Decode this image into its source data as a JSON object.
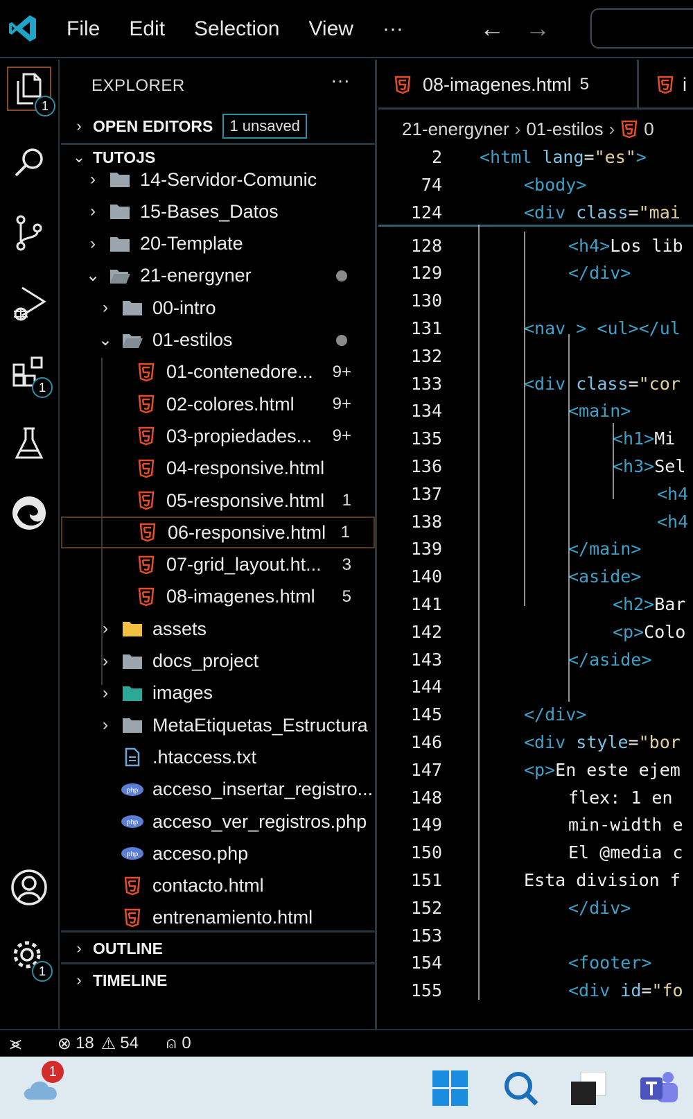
{
  "menu": [
    "File",
    "Edit",
    "Selection",
    "View",
    "···"
  ],
  "activity_bar": {
    "explorer_badge": "1",
    "extensions_badge": "1",
    "settings_badge": "1"
  },
  "sidebar": {
    "title": "EXPLORER",
    "more": "···",
    "open_editors": {
      "label": "OPEN EDITORS",
      "unsaved": "1 unsaved"
    },
    "root": "TUTOJS",
    "tree": [
      {
        "label": "14-Servidor-Comunic",
        "type": "folder",
        "level": 1,
        "expanded": false
      },
      {
        "label": "15-Bases_Datos",
        "type": "folder",
        "level": 1,
        "expanded": false
      },
      {
        "label": "20-Template",
        "type": "folder",
        "level": 1,
        "expanded": false
      },
      {
        "label": "21-energyner",
        "type": "folder-open",
        "level": 1,
        "expanded": true,
        "modified": true
      },
      {
        "label": "00-intro",
        "type": "folder",
        "level": 2,
        "expanded": false
      },
      {
        "label": "01-estilos",
        "type": "folder-open",
        "level": 2,
        "expanded": true,
        "modified": true
      },
      {
        "label": "01-contenedore...",
        "type": "html",
        "level": 3,
        "count": "9+"
      },
      {
        "label": "02-colores.html",
        "type": "html",
        "level": 3,
        "count": "9+"
      },
      {
        "label": "03-propiedades...",
        "type": "html",
        "level": 3,
        "count": "9+"
      },
      {
        "label": "04-responsive.html",
        "type": "html",
        "level": 3,
        "count": ""
      },
      {
        "label": "05-responsive.html",
        "type": "html",
        "level": 3,
        "count": "1"
      },
      {
        "label": "06-responsive.html",
        "type": "html",
        "level": 3,
        "count": "1",
        "selected": true
      },
      {
        "label": "07-grid_layout.ht...",
        "type": "html",
        "level": 3,
        "count": "3"
      },
      {
        "label": "08-imagenes.html",
        "type": "html",
        "level": 3,
        "count": "5"
      },
      {
        "label": "assets",
        "type": "folder-assets",
        "level": 2,
        "expanded": false
      },
      {
        "label": "docs_project",
        "type": "folder",
        "level": 2,
        "expanded": false
      },
      {
        "label": "images",
        "type": "folder-images",
        "level": 2,
        "expanded": false
      },
      {
        "label": "MetaEtiquetas_Estructura",
        "type": "folder",
        "level": 2,
        "expanded": false
      },
      {
        "label": ".htaccess.txt",
        "type": "txt",
        "level": 2
      },
      {
        "label": "acceso_insertar_registro...",
        "type": "php",
        "level": 2
      },
      {
        "label": "acceso_ver_registros.php",
        "type": "php",
        "level": 2
      },
      {
        "label": "acceso.php",
        "type": "php",
        "level": 2
      },
      {
        "label": "contacto.html",
        "type": "html",
        "level": 2
      },
      {
        "label": "entrenamiento.html",
        "type": "html",
        "level": 2
      }
    ],
    "outline": "OUTLINE",
    "timeline": "TIMELINE"
  },
  "editor": {
    "tabs": [
      {
        "label": "08-imagenes.html",
        "count": "5"
      },
      {
        "label": "i",
        "count": ""
      }
    ],
    "breadcrumb": [
      "21-energyner",
      "01-estilos",
      "0"
    ],
    "sticky": [
      {
        "ln": "2",
        "indent": 0,
        "html": "<span class='tag'>&lt;html</span> <span class='attr'>lang</span>=<span class='str'>\"es\"</span><span class='tag'>&gt;</span>"
      },
      {
        "ln": "74",
        "indent": 1,
        "html": "<span class='tag'>&lt;body&gt;</span>"
      },
      {
        "ln": "124",
        "indent": 1,
        "html": "<span class='tag'>&lt;div</span> <span class='attr'>class</span>=<span class='str'>\"mai</span>"
      }
    ],
    "lines": [
      {
        "ln": "128",
        "indent": 2,
        "html": "<span class='tag'>&lt;h4&gt;</span><span class='txt'>Los lib</span>"
      },
      {
        "ln": "129",
        "indent": 2,
        "html": "<span class='tag'>&lt;/div&gt;</span>"
      },
      {
        "ln": "130",
        "indent": 0,
        "html": ""
      },
      {
        "ln": "131",
        "indent": 1,
        "html": "<span class='tag'>&lt;nav</span> <span class='tag'>&gt;</span> <span class='tag'>&lt;ul&gt;&lt;/ul</span>"
      },
      {
        "ln": "132",
        "indent": 0,
        "html": ""
      },
      {
        "ln": "133",
        "indent": 1,
        "html": "<span class='tag'>&lt;div</span> <span class='attr'>class</span>=<span class='str'>\"cor</span>"
      },
      {
        "ln": "134",
        "indent": 2,
        "html": "<span class='tag'>&lt;main&gt;</span>"
      },
      {
        "ln": "135",
        "indent": 3,
        "html": "<span class='tag'>&lt;h1&gt;</span><span class='txt'>Mi </span>"
      },
      {
        "ln": "136",
        "indent": 3,
        "html": "<span class='tag'>&lt;h3&gt;</span><span class='txt'>Sel</span>"
      },
      {
        "ln": "137",
        "indent": 4,
        "html": "<span class='tag'>&lt;h4</span>"
      },
      {
        "ln": "138",
        "indent": 4,
        "html": "<span class='tag'>&lt;h4</span>"
      },
      {
        "ln": "139",
        "indent": 2,
        "html": "<span class='tag'>&lt;/main&gt;</span>"
      },
      {
        "ln": "140",
        "indent": 2,
        "html": "<span class='tag'>&lt;aside&gt;</span>"
      },
      {
        "ln": "141",
        "indent": 3,
        "html": "<span class='tag'>&lt;h2&gt;</span><span class='txt'>Bar</span>"
      },
      {
        "ln": "142",
        "indent": 3,
        "html": "<span class='tag'>&lt;p&gt;</span><span class='txt'>Colo</span>"
      },
      {
        "ln": "143",
        "indent": 2,
        "html": "<span class='tag'>&lt;/aside&gt;</span>"
      },
      {
        "ln": "144",
        "indent": 0,
        "html": ""
      },
      {
        "ln": "145",
        "indent": 1,
        "html": "<span class='tag'>&lt;/div&gt;</span>"
      },
      {
        "ln": "146",
        "indent": 1,
        "html": "<span class='tag'>&lt;div</span> <span class='attr'>style</span>=<span class='str'>\"bor</span>"
      },
      {
        "ln": "147",
        "indent": 1,
        "html": "<span class='tag'>&lt;p&gt;</span><span class='txt'>En este ejem</span>"
      },
      {
        "ln": "148",
        "indent": 2,
        "html": "<span class='txt'>flex: 1 en </span>"
      },
      {
        "ln": "149",
        "indent": 2,
        "html": "<span class='txt'>min-width e</span>"
      },
      {
        "ln": "150",
        "indent": 2,
        "html": "<span class='txt'>El @media c</span>"
      },
      {
        "ln": "151",
        "indent": 1,
        "html": "<span class='txt'>Esta division f</span>"
      },
      {
        "ln": "152",
        "indent": 2,
        "html": "<span class='tag'>&lt;/div&gt;</span>"
      },
      {
        "ln": "153",
        "indent": 0,
        "html": ""
      },
      {
        "ln": "154",
        "indent": 2,
        "html": "<span class='tag'>&lt;footer&gt;</span>"
      },
      {
        "ln": "155",
        "indent": 2,
        "html": "<span class='tag'>&lt;div</span> <span class='attr'>id</span>=<span class='str'>\"fo</span>"
      }
    ]
  },
  "statusbar": {
    "errors": "18",
    "warnings": "54",
    "ports": "0"
  },
  "taskbar": {
    "weather_badge": "1"
  },
  "colors": {
    "accent": "#2e8ea5",
    "html_icon": "#e44d26",
    "php_icon": "#5b7fd6",
    "folder": "#9aa5ad"
  }
}
